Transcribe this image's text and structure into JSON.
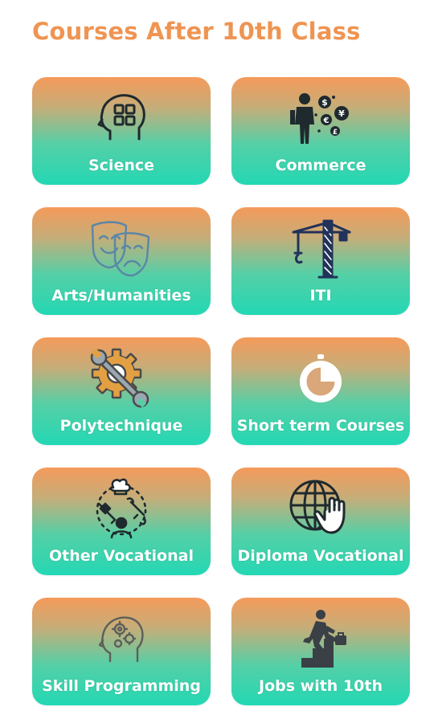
{
  "header": {
    "title": "Courses After 10th Class"
  },
  "accent_color": "#ef9452",
  "card_gradient": [
    "#f59a5a",
    "#22d8b4"
  ],
  "cards": [
    {
      "label": "Science",
      "icon": "brain-grid-icon"
    },
    {
      "label": "Commerce",
      "icon": "businessman-coins-icon"
    },
    {
      "label": "Arts/Humanities",
      "icon": "theater-masks-icon"
    },
    {
      "label": "ITI",
      "icon": "tower-crane-icon"
    },
    {
      "label": "Polytechnique",
      "icon": "gear-wrench-icon"
    },
    {
      "label": "Short term Courses",
      "icon": "stopwatch-icon"
    },
    {
      "label": "Other Vocational",
      "icon": "vocational-tools-icon"
    },
    {
      "label": "Diploma Vocational",
      "icon": "globe-hand-icon"
    },
    {
      "label": "Skill Programming",
      "icon": "head-gears-icon"
    },
    {
      "label": "Jobs with 10th",
      "icon": "climbing-stairs-icon"
    }
  ]
}
